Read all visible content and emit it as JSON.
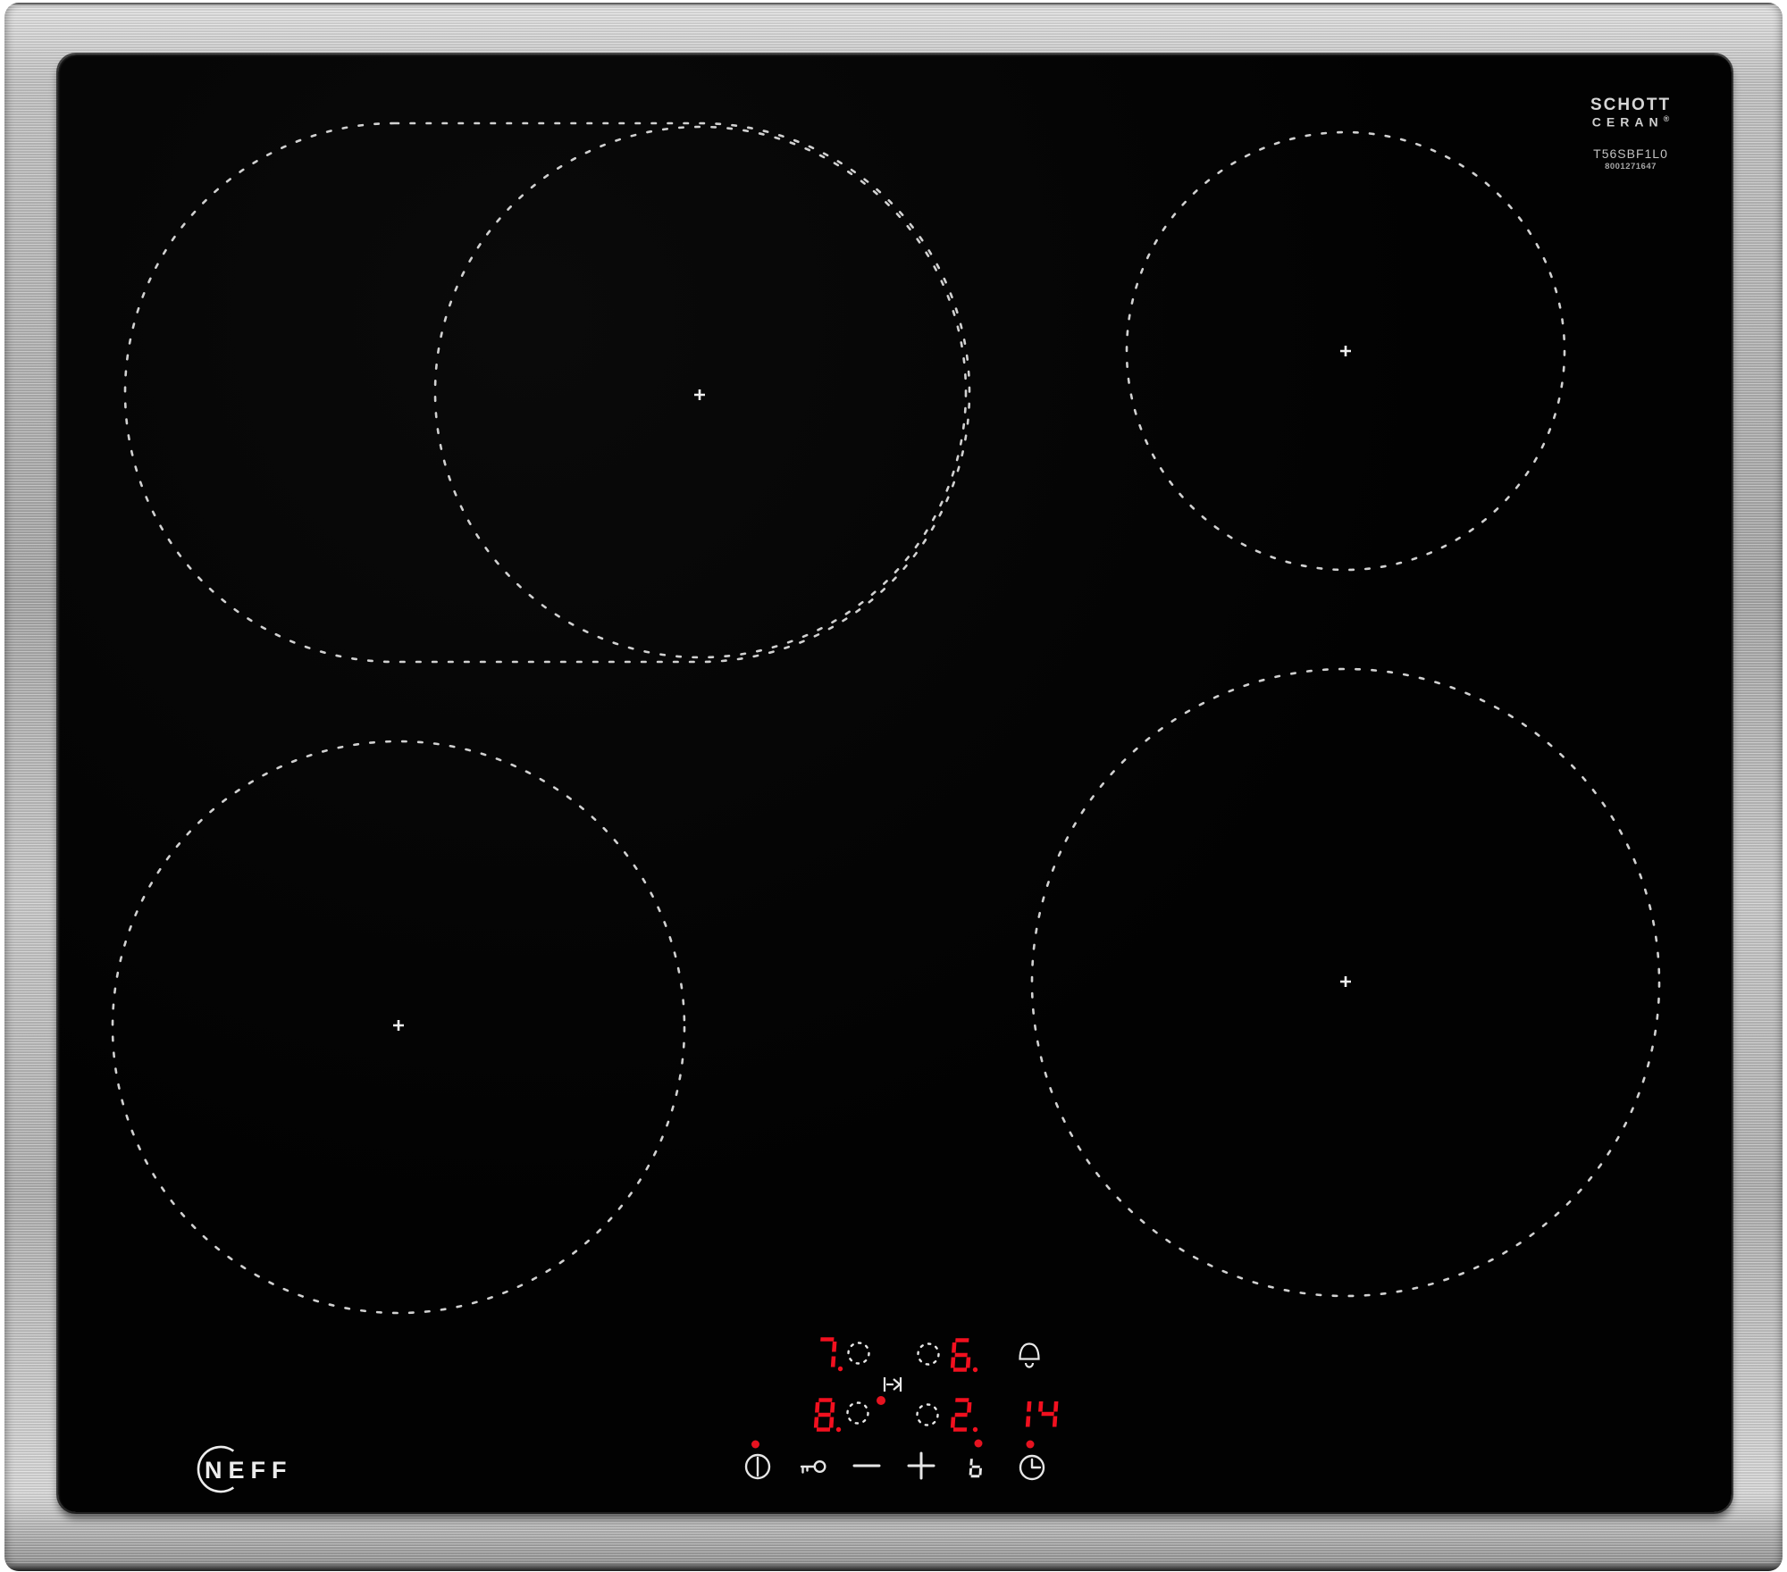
{
  "product": {
    "type": "induction-hob"
  },
  "brand": {
    "logo_text": "NEFF",
    "logo_icon": "neff-circle-arc-icon"
  },
  "glass_branding": {
    "maker_line1": "SCHOTT",
    "maker_line2": "CERAN",
    "registered_mark": "®",
    "model_number": "T56SBF1L0",
    "serial_number": "8001271647"
  },
  "display": {
    "row1_left": "7.",
    "row1_right": "6.",
    "row2_left": "8.",
    "row2_right": "2.",
    "timer": "14",
    "bell_icon": "bell-icon",
    "bridge_icon": "bridge-zone-icon",
    "zone_indicator_icon": "dotted-circle-icon",
    "active_indicator_icon": "red-dot-icon"
  },
  "controls": {
    "boost_symbol": "b",
    "buttons": [
      {
        "label": "power",
        "icon": "power-icon"
      },
      {
        "label": "child-lock",
        "icon": "key-icon"
      },
      {
        "label": "decrease",
        "icon": "minus-icon"
      },
      {
        "label": "increase",
        "icon": "plus-icon"
      },
      {
        "label": "boost",
        "icon": "seven-segment-b-icon"
      },
      {
        "label": "timer",
        "icon": "clock-icon"
      }
    ]
  },
  "zones": [
    {
      "name": "flex-back-left",
      "marker": "+"
    },
    {
      "name": "back-right",
      "marker": "+"
    },
    {
      "name": "front-left",
      "marker": "+"
    },
    {
      "name": "front-right",
      "marker": "+"
    }
  ],
  "colors": {
    "led_red": "#f2101f",
    "indicator_red": "#e61320",
    "zone_dot_white": "#dcdcdc",
    "glass_black": "#040404"
  }
}
